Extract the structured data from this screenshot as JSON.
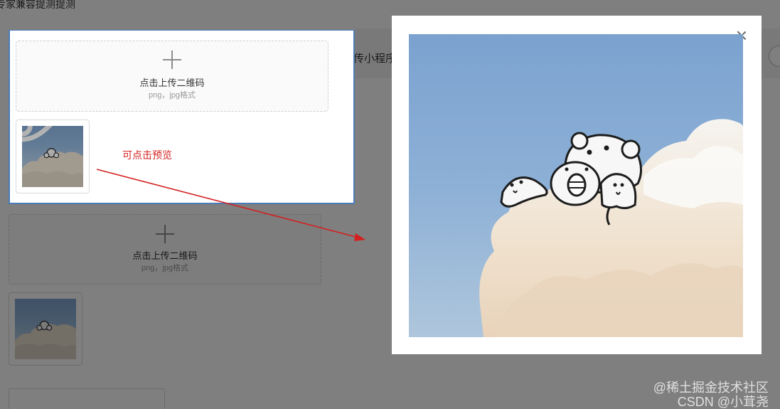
{
  "page": {
    "heading": "专家兼容提测提测",
    "header_fragment": "传小程序"
  },
  "upload": {
    "plus_icon": "plus-icon",
    "title": "点击上传二维码",
    "hint": "png，jpg格式"
  },
  "callout": {
    "note": "可点击预览",
    "note_color": "#d42020",
    "preview_icon": "eye-icon"
  },
  "preview_modal": {
    "close_icon": "close-icon",
    "image_alt": "bear-in-clouds-qr-image"
  },
  "watermark": {
    "line1": "@稀土掘金技术社区",
    "line2": "CSDN @小茸尧"
  },
  "colors": {
    "overlay": "rgba(0,0,0,0.5)",
    "callout_border": "#4a7bb7",
    "arrow": "#d42020",
    "sky": "#7ea3cf"
  }
}
